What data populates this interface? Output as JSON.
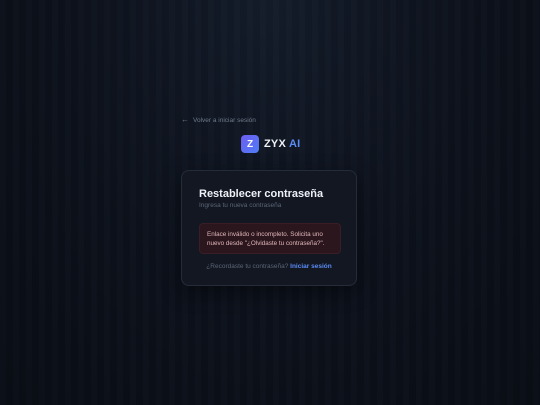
{
  "back_link": {
    "icon": "arrow-left-icon",
    "label": "Volver a iniciar sesión"
  },
  "brand": {
    "logo_letter": "Z",
    "name": "ZYX",
    "accent": "AI",
    "accent_color": "#5b8cf5"
  },
  "card": {
    "title": "Restablecer contraseña",
    "subtitle": "Ingresa tu nueva contraseña",
    "alert": {
      "type": "error",
      "message": "Enlace inválido o incompleto. Solicita uno nuevo desde \"¿Olvidaste tu contraseña?\"."
    },
    "footer": {
      "prompt": "¿Recordaste tu contraseña?",
      "link_label": "Iniciar sesión"
    }
  }
}
